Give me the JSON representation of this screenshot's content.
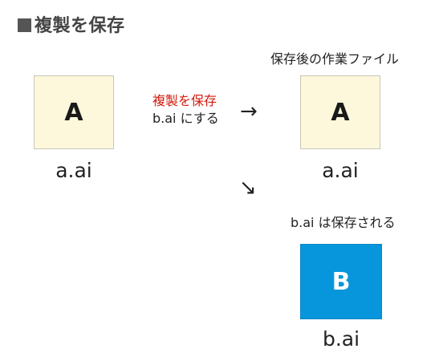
{
  "heading": "複製を保存",
  "source_file": {
    "letter": "A",
    "name": "a.ai"
  },
  "action": {
    "title": "複製を保存",
    "subtitle": "b.ai にする",
    "color": "#d4190c"
  },
  "working_file": {
    "caption": "保存後の作業ファイル",
    "letter": "A",
    "name": "a.ai"
  },
  "saved_file": {
    "caption": "b.ai は保存される",
    "letter": "B",
    "name": "b.ai"
  },
  "arrows": {
    "right": "→",
    "down_right": "↘"
  },
  "colors": {
    "cream_box": "#fdf8dc",
    "blue_box": "#0796dc"
  }
}
